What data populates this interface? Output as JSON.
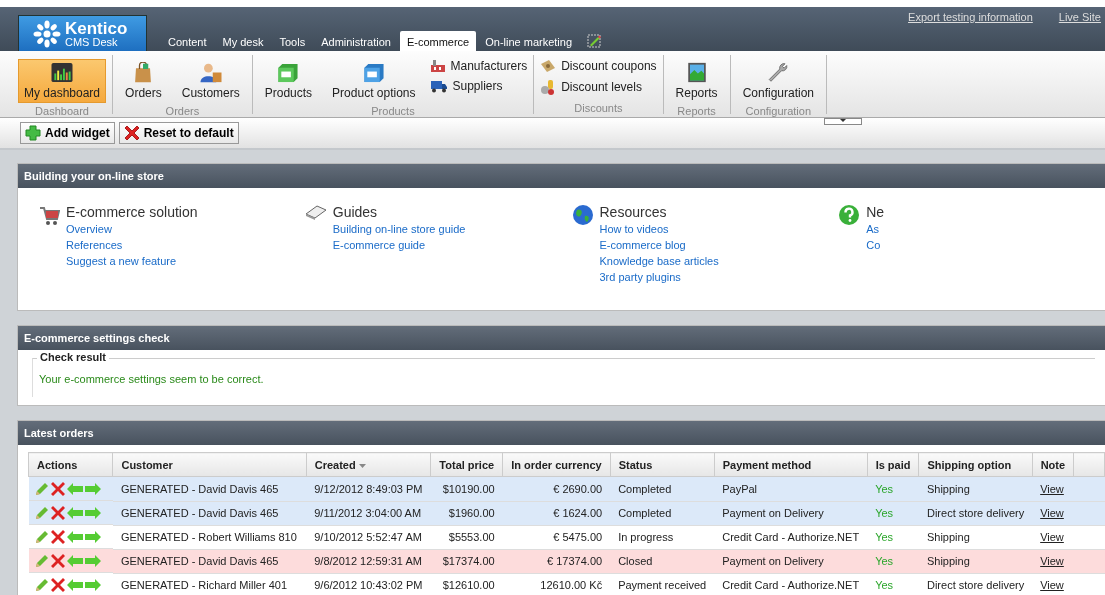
{
  "header": {
    "logo": {
      "name": "Kentico",
      "subtitle": "CMS Desk"
    },
    "tabs": [
      {
        "label": "Content",
        "selected": false
      },
      {
        "label": "My desk",
        "selected": false
      },
      {
        "label": "Tools",
        "selected": false
      },
      {
        "label": "Administration",
        "selected": false
      },
      {
        "label": "E-commerce",
        "selected": true
      },
      {
        "label": "On-line marketing",
        "selected": false
      }
    ],
    "links": [
      "Export testing information",
      "Live Site"
    ]
  },
  "ribbon": [
    {
      "label": "Dashboard",
      "items": [
        {
          "label": "My dashboard",
          "kind": "large",
          "selected": true
        }
      ]
    },
    {
      "label": "Orders",
      "items": [
        {
          "label": "Orders",
          "kind": "large",
          "selected": false
        },
        {
          "label": "Customers",
          "kind": "large",
          "selected": false
        }
      ]
    },
    {
      "label": "Products",
      "items": [
        {
          "label": "Products",
          "kind": "large",
          "selected": false
        },
        {
          "label": "Product options",
          "kind": "large",
          "selected": false
        },
        {
          "label": "Manufacturers",
          "kind": "small"
        },
        {
          "label": "Suppliers",
          "kind": "small"
        }
      ]
    },
    {
      "label": "Discounts",
      "items": [
        {
          "label": "Discount coupons",
          "kind": "small"
        },
        {
          "label": "Discount levels",
          "kind": "small"
        }
      ]
    },
    {
      "label": "Reports",
      "items": [
        {
          "label": "Reports",
          "kind": "large",
          "selected": false
        }
      ]
    },
    {
      "label": "Configuration",
      "items": [
        {
          "label": "Configuration",
          "kind": "large",
          "selected": false
        }
      ]
    }
  ],
  "toolbar": [
    "Add widget",
    "Reset to default"
  ],
  "store_panel": {
    "title": "Building your on-line store",
    "sections": [
      {
        "heading": "E-commerce solution",
        "links": [
          "Overview",
          "References",
          "Suggest a new feature"
        ]
      },
      {
        "heading": "Guides",
        "links": [
          "Building on-line store guide",
          "E-commerce guide"
        ]
      },
      {
        "heading": "Resources",
        "links": [
          "How to videos",
          "E-commerce blog",
          "Knowledge base articles",
          "3rd party plugins"
        ]
      },
      {
        "heading": "Ne",
        "links": [
          "As",
          "Co"
        ]
      }
    ]
  },
  "settings_panel": {
    "title": "E-commerce settings check",
    "legend": "Check result",
    "message": "Your e-commerce settings seem to be correct."
  },
  "orders_panel": {
    "title": "Latest orders",
    "columns": [
      {
        "label": "Actions",
        "sorted": false
      },
      {
        "label": "Customer",
        "sorted": false
      },
      {
        "label": "Created",
        "sorted": true
      },
      {
        "label": "Total price",
        "sorted": false
      },
      {
        "label": "In order currency",
        "sorted": false
      },
      {
        "label": "Status",
        "sorted": false
      },
      {
        "label": "Payment method",
        "sorted": false
      },
      {
        "label": "Is paid",
        "sorted": false
      },
      {
        "label": "Shipping option",
        "sorted": false
      },
      {
        "label": "Note",
        "sorted": false
      }
    ],
    "rows": [
      {
        "color": "#dce9f9",
        "cells": [
          "",
          "GENERATED - David Davis 465",
          "9/12/2012 8:49:03 PM",
          "$10190.00",
          "€ 2690.00",
          "Completed",
          "PayPal",
          "Yes",
          "Shipping",
          "View"
        ]
      },
      {
        "color": "#dce9f9",
        "cells": [
          "",
          "GENERATED - David Davis 465",
          "9/11/2012 3:04:00 AM",
          "$1960.00",
          "€ 1624.00",
          "Completed",
          "Payment on Delivery",
          "Yes",
          "Direct store delivery",
          "View"
        ]
      },
      {
        "color": "#ffffff",
        "cells": [
          "",
          "GENERATED - Robert Williams 810",
          "9/10/2012 5:52:47 AM",
          "$5553.00",
          "€ 5475.00",
          "In progress",
          "Credit Card - Authorize.NET",
          "Yes",
          "Shipping",
          "View"
        ]
      },
      {
        "color": "#fddcdc",
        "cells": [
          "",
          "GENERATED - David Davis 465",
          "9/8/2012 12:59:31 AM",
          "$17374.00",
          "€ 17374.00",
          "Closed",
          "Payment on Delivery",
          "Yes",
          "Shipping",
          "View"
        ]
      },
      {
        "color": "#ffffff",
        "cells": [
          "",
          "GENERATED - Richard Miller 401",
          "9/6/2012 10:43:02 PM",
          "$12610.00",
          "12610.00 Kč",
          "Payment received",
          "Credit Card - Authorize.NET",
          "Yes",
          "Direct store delivery",
          "View"
        ]
      }
    ]
  }
}
